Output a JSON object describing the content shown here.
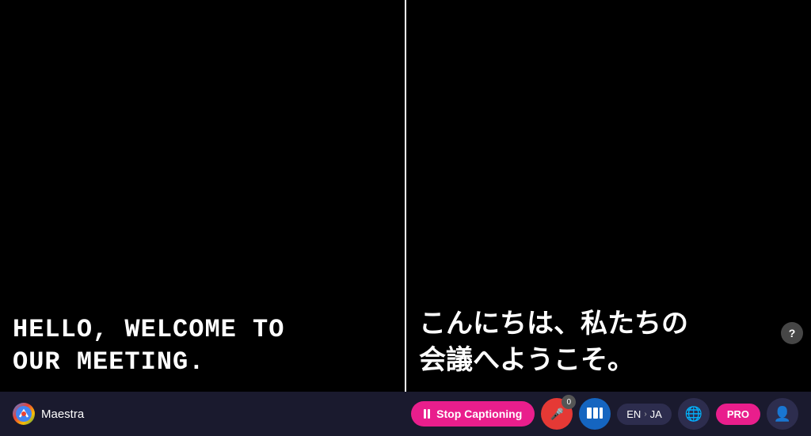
{
  "brand": {
    "name": "Maestra",
    "logo_text": "M"
  },
  "panels": {
    "left": {
      "caption": "HELLO, WELCOME TO\nOUR MEETING."
    },
    "right": {
      "caption": "こんにちは、私たちの\n会議へようこそ。"
    }
  },
  "toolbar": {
    "stop_captioning_label": "Stop Captioning",
    "mic_count": "0",
    "lang_from": "EN",
    "lang_to": "JA",
    "pro_label": "PRO"
  },
  "help": {
    "label": "?"
  }
}
